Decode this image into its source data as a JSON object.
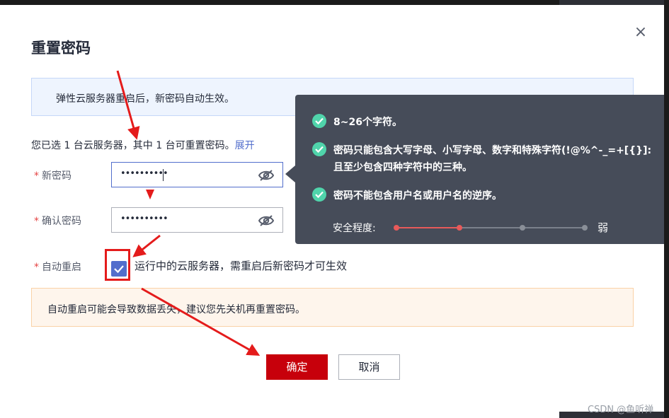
{
  "dialog": {
    "title": "重置密码",
    "info": "弹性云服务器重启后，新密码自动生效。",
    "selected_text": "您已选 1 台云服务器，其中 1 台可重置密码。",
    "expand_link": "展开",
    "required_mark": "*",
    "new_password": {
      "label": "新密码",
      "value": "••••••••••"
    },
    "confirm_password": {
      "label": "确认密码",
      "value": "••••••••••"
    },
    "auto_restart": {
      "label": "自动重启",
      "checked": true,
      "text": "运行中的云服务器，需重启后新密码才可生效"
    },
    "warning": "自动重启可能会导致数据丢失，建议您先关机再重置密码。",
    "ok_button": "确定",
    "cancel_button": "取消",
    "close_icon": "×"
  },
  "tooltip": {
    "rules": [
      {
        "icon": "check-circle-icon",
        "lines": [
          "8~26个字符。"
        ]
      },
      {
        "icon": "check-circle-icon",
        "lines": [
          "密码只能包含大写字母、小写字母、数字和特殊字符(!@%^-_=+[{}]:",
          "且至少包含四种字符中的三种。"
        ]
      },
      {
        "icon": "check-circle-icon",
        "lines": [
          "密码不能包含用户名或用户名的逆序。"
        ]
      }
    ],
    "strength_label": "安全程度:",
    "strength_value": "弱",
    "strength_level": 0.33
  },
  "watermark": "CSDN @鱼听禅",
  "colors": {
    "primary": "#526ecc",
    "danger": "#c7000b",
    "success": "#50d4ab",
    "annotation": "#e41b1b"
  }
}
